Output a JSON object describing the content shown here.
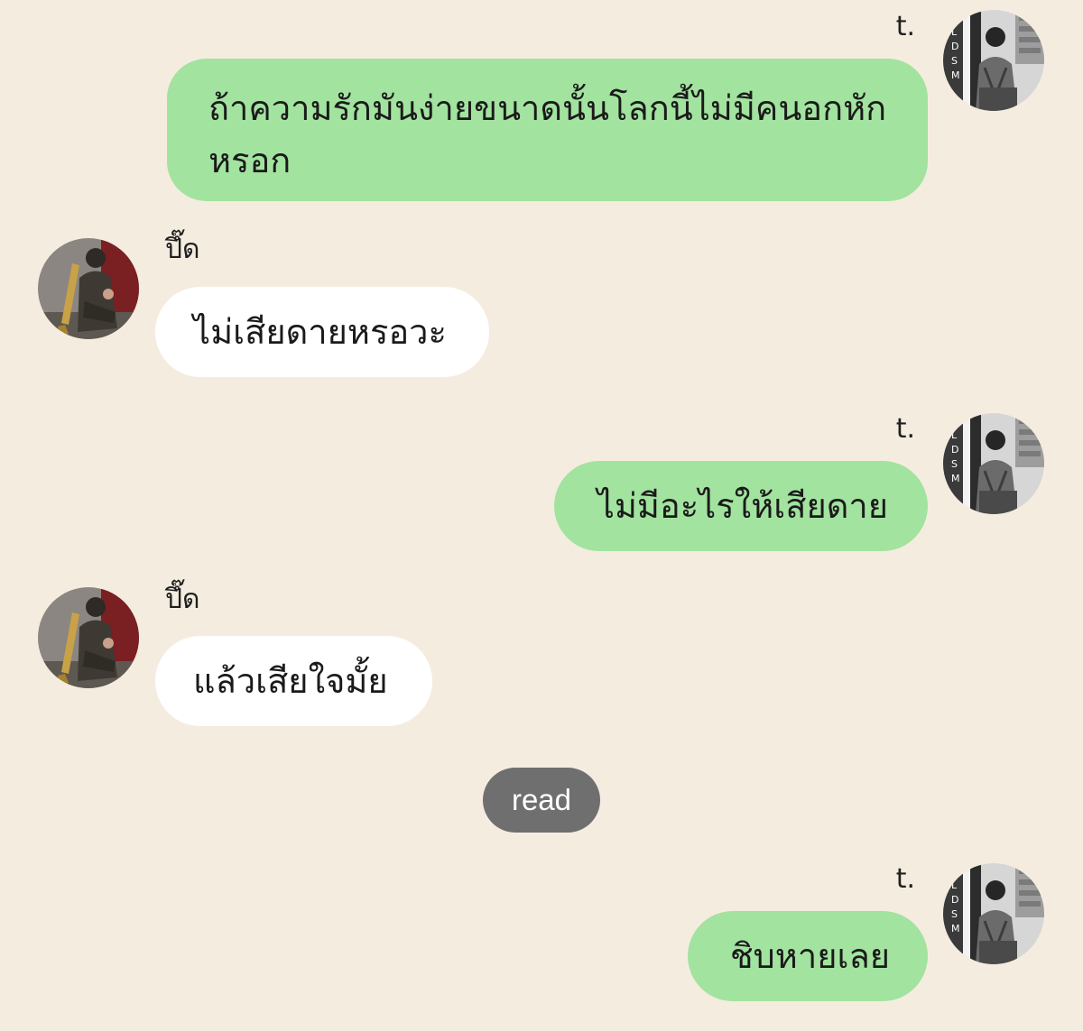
{
  "colors": {
    "background": "#f5ece0",
    "outgoing_bubble": "#a2e39f",
    "incoming_bubble": "#ffffff",
    "read_pill": "#6f6f6f"
  },
  "participants": {
    "me": {
      "name": "t.",
      "avatar_icon": "profile-photo-icon"
    },
    "other": {
      "name": "ปึ๊ด",
      "avatar_icon": "profile-photo-icon"
    }
  },
  "messages": [
    {
      "sender": "t.",
      "direction": "outgoing",
      "lines": [
        "ถ้าความรักมันง่ายขนาดนั้นโลกนี้ไม่มีคนอกหัก",
        "หรอก"
      ]
    },
    {
      "sender": "ปึ๊ด",
      "direction": "incoming",
      "text": "ไม่เสียดายหรอวะ"
    },
    {
      "sender": "t.",
      "direction": "outgoing",
      "text": "ไม่มีอะไรให้เสียดาย"
    },
    {
      "sender": "ปึ๊ด",
      "direction": "incoming",
      "text": "แล้วเสียใจมั้ย"
    },
    {
      "sender": "t.",
      "direction": "outgoing",
      "text": "ชิบหายเลย"
    }
  ],
  "status": {
    "read_label": "read"
  }
}
